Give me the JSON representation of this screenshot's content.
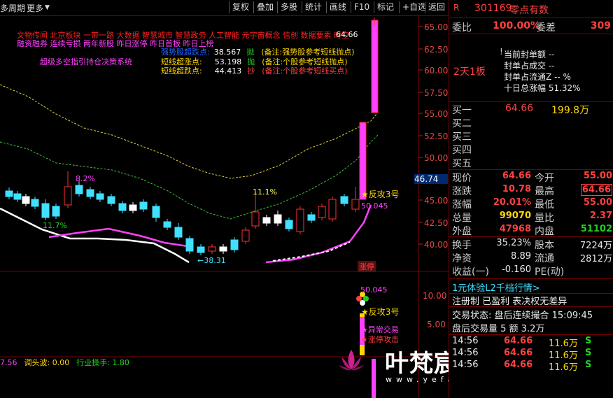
{
  "toolbar": {
    "period": "多周期",
    "more": "更多",
    "buttons": [
      "复权",
      "叠加",
      "多股",
      "统计",
      "画线",
      "F10",
      "标记",
      "+自选",
      "返回"
    ]
  },
  "chart": {
    "concept_line1": "文物传闻 北京板块 一带一路 大数据 智慧城市 智慧政务 人工智能 元宇宙概念 信创 数据要素 时空",
    "concept_line2": "融资融券 连续亏损 两年新股 昨日涨停 昨日首板 昨日上榜",
    "high_marker": "64.66",
    "indicator_title": "超级多空指引持仓决策系统",
    "ind_rows": [
      {
        "name": "强势股超跌点:",
        "value": "38.567",
        "tag": "抛",
        "note": "(备注:强势股参考短线抛点)"
      },
      {
        "name": "短线超涨点:",
        "value": "53.198",
        "tag": "抛",
        "note": "(备注:个股参考短线抛点)"
      },
      {
        "name": "短线超跌点:",
        "value": "44.413",
        "tag": "抄",
        "note": "(备注:个股参考短线买点)"
      }
    ],
    "annotations": {
      "pct_a": "8.2%",
      "pct_b": "11.7%",
      "pct_c": "11.1%",
      "low_marker": "38.31",
      "reverse_label": "★反攻3号",
      "line_value": "50.045",
      "limit_tag": "涨停",
      "sub_value": "50.045",
      "sub_reverse": "★反攻3号",
      "sub_abnormal": "★异常交易",
      "sub_attack": "★涨停攻击"
    },
    "price_ticks": [
      "65.00",
      "62.50",
      "60.00",
      "57.50",
      "55.00",
      "52.50",
      "50.00",
      "46.74",
      "45.00",
      "42.50",
      "40.00"
    ],
    "sub_ticks": [
      "10.00",
      "5.00"
    ],
    "bottom_bar": [
      {
        "text": "7.56",
        "color": "#ff40ff"
      },
      {
        "text": "调头波: 0.00",
        "color": "#ffd700"
      },
      {
        "text": "行业操手: 1.80",
        "color": "#20d020"
      }
    ],
    "watermark": "叶梵宸指标公式网",
    "watermark_url": "www.yefanchen.com"
  },
  "panel": {
    "code": "301169",
    "name": "零点有数",
    "weibi_label": "委比",
    "weibi_value": "100.00%",
    "weicha_label": "委差",
    "weicha_value": "309",
    "seal_items": [
      "当前封单额 --",
      "封单占成交 --",
      "封单占流通Z -- %",
      "十日总涨幅 51.32%"
    ],
    "board_tag": "2天1板",
    "buys": [
      {
        "label": "买一",
        "price": "64.66",
        "vol": "199.8万"
      },
      {
        "label": "买二",
        "price": "",
        "vol": ""
      },
      {
        "label": "买三",
        "price": "",
        "vol": ""
      },
      {
        "label": "买四",
        "price": "",
        "vol": ""
      },
      {
        "label": "买五",
        "price": "",
        "vol": ""
      }
    ],
    "quote": [
      {
        "l1": "现价",
        "v1": "64.66",
        "l2": "今开",
        "v2": "55.00"
      },
      {
        "l1": "涨跌",
        "v1": "10.78",
        "l2": "最高",
        "v2": "64.66"
      },
      {
        "l1": "涨幅",
        "v1": "20.01%",
        "l2": "最低",
        "v2": "55.00"
      },
      {
        "l1": "总量",
        "v1": "99070",
        "l2": "量比",
        "v2": "2.37"
      },
      {
        "l1": "外盘",
        "v1": "47968",
        "l2": "内盘",
        "v2": "51102"
      }
    ],
    "stats": [
      {
        "l1": "换手",
        "v1": "35.23%",
        "l2": "股本",
        "v2": "7224万"
      },
      {
        "l1": "净资",
        "v1": "8.89",
        "l2": "流通",
        "v2": "2812万"
      },
      {
        "l1": "收益(一)",
        "v1": "-0.160",
        "l2": "PE(动)",
        "v2": ""
      }
    ],
    "promo": "1元体验L2千档行情>",
    "register": "注册制 已盈利 表决权无差异",
    "trade_state": "交易状态: 盘后连续撮合 15:09:45",
    "after_volume": "盘后交易量 5 额 3.2万",
    "ticks": [
      {
        "time": "14:56",
        "price": "64.66",
        "vol": "11.6万",
        "side": "S"
      },
      {
        "time": "14:56",
        "price": "64.66",
        "vol": "11.6万",
        "side": "S"
      },
      {
        "time": "14:56",
        "price": "64.66",
        "vol": "11.6万",
        "side": "S"
      }
    ]
  }
}
